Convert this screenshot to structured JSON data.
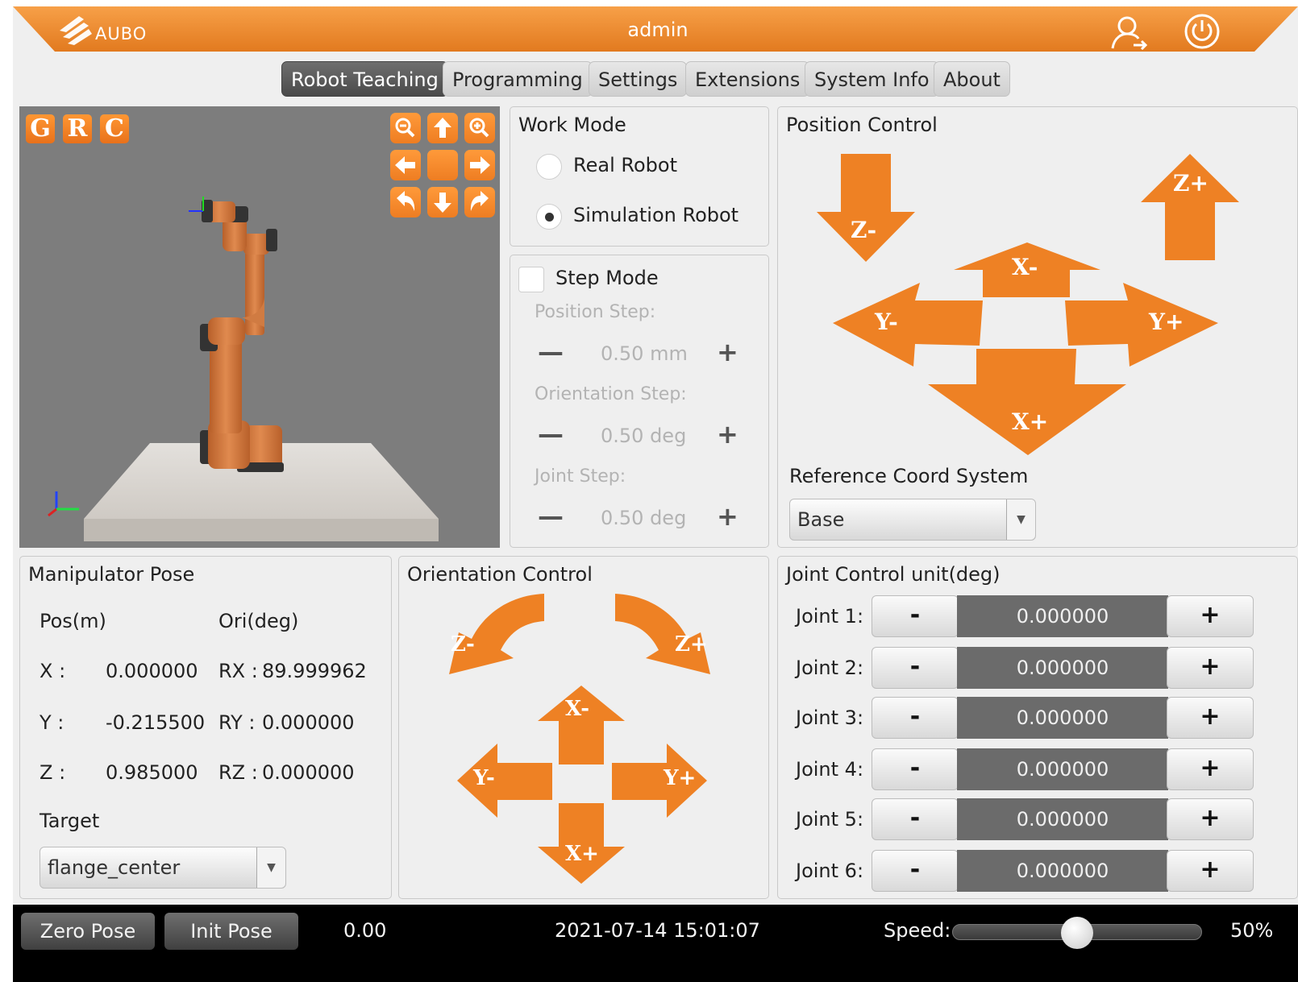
{
  "header": {
    "brand": "AUBO",
    "user": "admin",
    "icons": [
      "user-switch-icon",
      "power-icon"
    ]
  },
  "tabs": [
    {
      "label": "Robot Teaching",
      "active": true
    },
    {
      "label": "Programming",
      "active": false
    },
    {
      "label": "Settings",
      "active": false
    },
    {
      "label": "Extensions",
      "active": false
    },
    {
      "label": "System Info",
      "active": false
    },
    {
      "label": "About",
      "active": false
    }
  ],
  "viewport": {
    "view_buttons": [
      "G",
      "R",
      "C"
    ],
    "camera_controls": [
      "zoom-out-icon",
      "arrow-up-icon",
      "zoom-in-icon",
      "arrow-left-icon",
      "center-icon",
      "arrow-right-icon",
      "rotate-left-icon",
      "arrow-down-icon",
      "rotate-right-icon"
    ]
  },
  "work_mode": {
    "title": "Work Mode",
    "options": [
      {
        "label": "Real Robot",
        "selected": false
      },
      {
        "label": "Simulation Robot",
        "selected": true
      }
    ]
  },
  "step_mode": {
    "label": "Step Mode",
    "checked": false,
    "position_step": {
      "label": "Position Step:",
      "value": "0.50 mm"
    },
    "orientation_step": {
      "label": "Orientation Step:",
      "value": "0.50 deg"
    },
    "joint_step": {
      "label": "Joint Step:",
      "value": "0.50 deg"
    },
    "minus": "—",
    "plus": "+"
  },
  "position_control": {
    "title": "Position Control",
    "arrows": {
      "z_minus": "Z-",
      "z_plus": "Z+",
      "x_minus": "X-",
      "x_plus": "X+",
      "y_minus": "Y-",
      "y_plus": "Y+"
    },
    "ref_label": "Reference Coord System",
    "ref_value": "Base"
  },
  "pose": {
    "title": "Manipulator Pose",
    "pos_header": "Pos(m)",
    "ori_header": "Ori(deg)",
    "rows": [
      {
        "pos_label": "X :",
        "pos_value": "0.000000",
        "ori_label": "RX :",
        "ori_value": "89.999962"
      },
      {
        "pos_label": "Y :",
        "pos_value": "-0.215500",
        "ori_label": "RY :",
        "ori_value": "0.000000"
      },
      {
        "pos_label": "Z :",
        "pos_value": "0.985000",
        "ori_label": "RZ :",
        "ori_value": "0.000000"
      }
    ],
    "target_label": "Target",
    "target_value": "flange_center"
  },
  "orientation_control": {
    "title": "Orientation Control",
    "arrows": {
      "z_minus": "Z-",
      "z_plus": "Z+",
      "x_minus": "X-",
      "x_plus": "X+",
      "y_minus": "Y-",
      "y_plus": "Y+"
    }
  },
  "joint_control": {
    "title": "Joint Control  unit(deg)",
    "minus": "-",
    "plus": "+",
    "joints": [
      {
        "label": "Joint 1:",
        "value": "0.000000"
      },
      {
        "label": "Joint 2:",
        "value": "0.000000"
      },
      {
        "label": "Joint 3:",
        "value": "0.000000"
      },
      {
        "label": "Joint 4:",
        "value": "0.000000"
      },
      {
        "label": "Joint 5:",
        "value": "0.000000"
      },
      {
        "label": "Joint 6:",
        "value": "0.000000"
      }
    ]
  },
  "footer": {
    "zero_pose": "Zero Pose",
    "init_pose": "Init Pose",
    "value": "0.00",
    "datetime": "2021-07-14 15:01:07",
    "speed_label": "Speed:",
    "speed_value": "50%",
    "speed_fraction": 0.5
  },
  "colors": {
    "accent": "#ee8124",
    "header": "#f08a2e",
    "footer": "#000000",
    "joint_value_bg": "#6b6b6b"
  }
}
